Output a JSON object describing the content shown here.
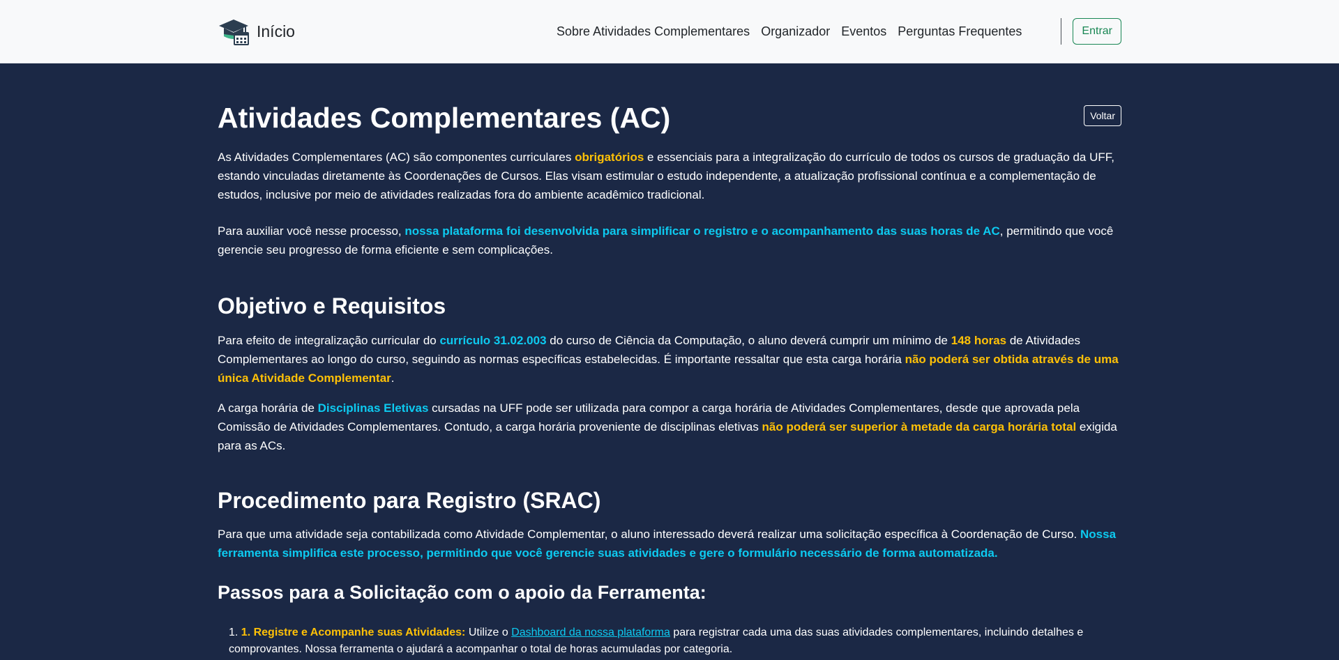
{
  "navbar": {
    "brand": "Início",
    "links": [
      "Sobre Atividades Complementares",
      "Organizador",
      "Eventos",
      "Perguntas Frequentes"
    ],
    "login_button": "Entrar"
  },
  "page": {
    "title": "Atividades Complementares (AC)",
    "back_button": "Voltar",
    "intro1": {
      "a": "As Atividades Complementares (AC) são componentes curriculares ",
      "b": "obrigatórios",
      "c": " e essenciais para a integralização do currículo de todos os cursos de graduação da UFF, estando vinculadas diretamente às Coordenações de Cursos. Elas visam estimular o estudo independente, a atualização profissional contínua e a complementação de estudos, inclusive por meio de atividades realizadas fora do ambiente acadêmico tradicional."
    },
    "intro2": {
      "a": "Para auxiliar você nesse processo, ",
      "b": "nossa plataforma foi desenvolvida para simplificar o registro e o acompanhamento das suas horas de AC",
      "c": ", permitindo que você gerencie seu progresso de forma eficiente e sem complicações."
    }
  },
  "objetivo": {
    "heading": "Objetivo e Requisitos",
    "p1": {
      "a": "Para efeito de integralização curricular do ",
      "b": "currículo 31.02.003",
      "c": " do curso de Ciência da Computação, o aluno deverá cumprir um mínimo de ",
      "d": "148 horas",
      "e": " de Atividades Complementares ao longo do curso, seguindo as normas específicas estabelecidas. É importante ressaltar que esta carga horária ",
      "f": "não poderá ser obtida através de uma única Atividade Complementar",
      "g": "."
    },
    "p2": {
      "a": "A carga horária de ",
      "b": "Disciplinas Eletivas",
      "c": " cursadas na UFF pode ser utilizada para compor a carga horária de Atividades Complementares, desde que aprovada pela Comissão de Atividades Complementares. Contudo, a carga horária proveniente de disciplinas eletivas ",
      "d": "não poderá ser superior à metade da carga horária total",
      "e": " exigida para as ACs."
    }
  },
  "procedimento": {
    "heading": "Procedimento para Registro (SRAC)",
    "p1": {
      "a": "Para que uma atividade seja contabilizada como Atividade Complementar, o aluno interessado deverá realizar uma solicitação específica à Coordenação de Curso. ",
      "b": "Nossa ferramenta simplifica este processo, permitindo que você gerencie suas atividades e gere o formulário necessário de forma automatizada."
    },
    "steps_heading": "Passos para a Solicitação com o apoio da Ferramenta:",
    "steps": [
      {
        "num": "1.",
        "title": "1. Registre e Acompanhe suas Atividades:",
        "a": " Utilize o ",
        "link": "Dashboard da nossa plataforma",
        "b": " para registrar cada uma das suas atividades complementares, incluindo detalhes e comprovantes. Nossa ferramenta o ajudará a acompanhar o total de horas acumuladas por categoria."
      }
    ]
  },
  "colors": {
    "background": "#1b2845",
    "navbar": "#f8f9fa",
    "highlight_yellow": "#ffc107",
    "highlight_cyan": "#0dcaf0",
    "login_green": "#198754"
  },
  "icons": {
    "brand": "graduation-cap-calendar-icon"
  }
}
